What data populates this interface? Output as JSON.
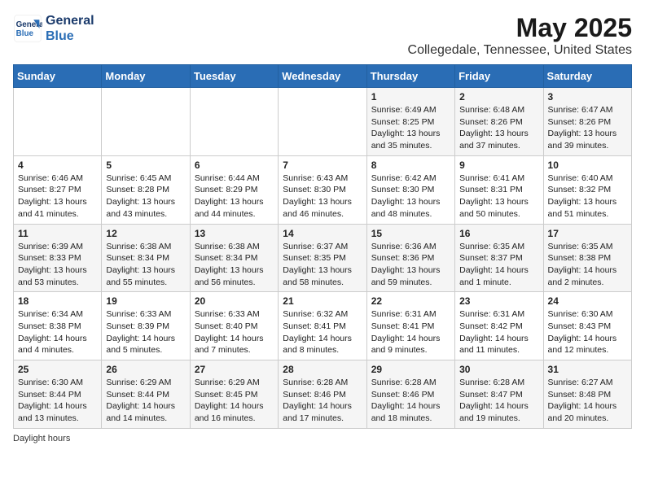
{
  "logo": {
    "line1": "General",
    "line2": "Blue"
  },
  "title": "May 2025",
  "location": "Collegedale, Tennessee, United States",
  "days_of_week": [
    "Sunday",
    "Monday",
    "Tuesday",
    "Wednesday",
    "Thursday",
    "Friday",
    "Saturday"
  ],
  "footer": "Daylight hours",
  "weeks": [
    [
      {
        "day": "",
        "info": ""
      },
      {
        "day": "",
        "info": ""
      },
      {
        "day": "",
        "info": ""
      },
      {
        "day": "",
        "info": ""
      },
      {
        "day": "1",
        "info": "Sunrise: 6:49 AM\nSunset: 8:25 PM\nDaylight: 13 hours\nand 35 minutes."
      },
      {
        "day": "2",
        "info": "Sunrise: 6:48 AM\nSunset: 8:26 PM\nDaylight: 13 hours\nand 37 minutes."
      },
      {
        "day": "3",
        "info": "Sunrise: 6:47 AM\nSunset: 8:26 PM\nDaylight: 13 hours\nand 39 minutes."
      }
    ],
    [
      {
        "day": "4",
        "info": "Sunrise: 6:46 AM\nSunset: 8:27 PM\nDaylight: 13 hours\nand 41 minutes."
      },
      {
        "day": "5",
        "info": "Sunrise: 6:45 AM\nSunset: 8:28 PM\nDaylight: 13 hours\nand 43 minutes."
      },
      {
        "day": "6",
        "info": "Sunrise: 6:44 AM\nSunset: 8:29 PM\nDaylight: 13 hours\nand 44 minutes."
      },
      {
        "day": "7",
        "info": "Sunrise: 6:43 AM\nSunset: 8:30 PM\nDaylight: 13 hours\nand 46 minutes."
      },
      {
        "day": "8",
        "info": "Sunrise: 6:42 AM\nSunset: 8:30 PM\nDaylight: 13 hours\nand 48 minutes."
      },
      {
        "day": "9",
        "info": "Sunrise: 6:41 AM\nSunset: 8:31 PM\nDaylight: 13 hours\nand 50 minutes."
      },
      {
        "day": "10",
        "info": "Sunrise: 6:40 AM\nSunset: 8:32 PM\nDaylight: 13 hours\nand 51 minutes."
      }
    ],
    [
      {
        "day": "11",
        "info": "Sunrise: 6:39 AM\nSunset: 8:33 PM\nDaylight: 13 hours\nand 53 minutes."
      },
      {
        "day": "12",
        "info": "Sunrise: 6:38 AM\nSunset: 8:34 PM\nDaylight: 13 hours\nand 55 minutes."
      },
      {
        "day": "13",
        "info": "Sunrise: 6:38 AM\nSunset: 8:34 PM\nDaylight: 13 hours\nand 56 minutes."
      },
      {
        "day": "14",
        "info": "Sunrise: 6:37 AM\nSunset: 8:35 PM\nDaylight: 13 hours\nand 58 minutes."
      },
      {
        "day": "15",
        "info": "Sunrise: 6:36 AM\nSunset: 8:36 PM\nDaylight: 13 hours\nand 59 minutes."
      },
      {
        "day": "16",
        "info": "Sunrise: 6:35 AM\nSunset: 8:37 PM\nDaylight: 14 hours\nand 1 minute."
      },
      {
        "day": "17",
        "info": "Sunrise: 6:35 AM\nSunset: 8:38 PM\nDaylight: 14 hours\nand 2 minutes."
      }
    ],
    [
      {
        "day": "18",
        "info": "Sunrise: 6:34 AM\nSunset: 8:38 PM\nDaylight: 14 hours\nand 4 minutes."
      },
      {
        "day": "19",
        "info": "Sunrise: 6:33 AM\nSunset: 8:39 PM\nDaylight: 14 hours\nand 5 minutes."
      },
      {
        "day": "20",
        "info": "Sunrise: 6:33 AM\nSunset: 8:40 PM\nDaylight: 14 hours\nand 7 minutes."
      },
      {
        "day": "21",
        "info": "Sunrise: 6:32 AM\nSunset: 8:41 PM\nDaylight: 14 hours\nand 8 minutes."
      },
      {
        "day": "22",
        "info": "Sunrise: 6:31 AM\nSunset: 8:41 PM\nDaylight: 14 hours\nand 9 minutes."
      },
      {
        "day": "23",
        "info": "Sunrise: 6:31 AM\nSunset: 8:42 PM\nDaylight: 14 hours\nand 11 minutes."
      },
      {
        "day": "24",
        "info": "Sunrise: 6:30 AM\nSunset: 8:43 PM\nDaylight: 14 hours\nand 12 minutes."
      }
    ],
    [
      {
        "day": "25",
        "info": "Sunrise: 6:30 AM\nSunset: 8:44 PM\nDaylight: 14 hours\nand 13 minutes."
      },
      {
        "day": "26",
        "info": "Sunrise: 6:29 AM\nSunset: 8:44 PM\nDaylight: 14 hours\nand 14 minutes."
      },
      {
        "day": "27",
        "info": "Sunrise: 6:29 AM\nSunset: 8:45 PM\nDaylight: 14 hours\nand 16 minutes."
      },
      {
        "day": "28",
        "info": "Sunrise: 6:28 AM\nSunset: 8:46 PM\nDaylight: 14 hours\nand 17 minutes."
      },
      {
        "day": "29",
        "info": "Sunrise: 6:28 AM\nSunset: 8:46 PM\nDaylight: 14 hours\nand 18 minutes."
      },
      {
        "day": "30",
        "info": "Sunrise: 6:28 AM\nSunset: 8:47 PM\nDaylight: 14 hours\nand 19 minutes."
      },
      {
        "day": "31",
        "info": "Sunrise: 6:27 AM\nSunset: 8:48 PM\nDaylight: 14 hours\nand 20 minutes."
      }
    ]
  ]
}
